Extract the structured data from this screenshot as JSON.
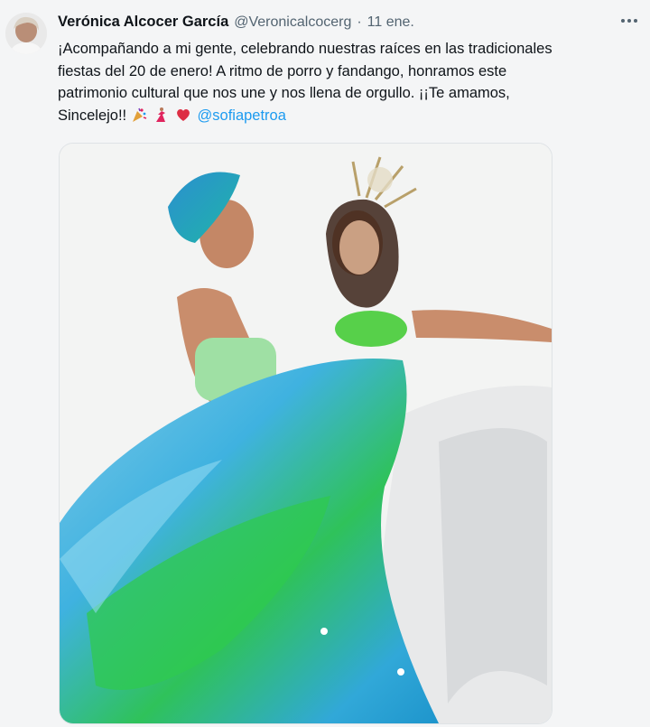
{
  "tweet": {
    "author_name": "Verónica Alcocer García",
    "author_handle": "@Veronicalcocerg",
    "separator": "·",
    "date": "11 ene.",
    "text_lines": [
      "¡Acompañando a mi gente, celebrando nuestras raíces en las tradicionales",
      "fiestas del 20 de enero! A ritmo de porro y fandango, honramos este",
      "patrimonio cultural que nos une y nos llena de orgullo. ¡¡Te amamos,",
      "Sincelejo!!"
    ],
    "mention": "@sofiapetroa",
    "emojis": [
      "party-popper",
      "dancer",
      "red-heart"
    ]
  },
  "colors": {
    "mention": "#1d9bf0",
    "secondary_text": "#536471",
    "background": "#f4f5f6"
  },
  "icons": {
    "more": "more-horizontal-icon"
  }
}
